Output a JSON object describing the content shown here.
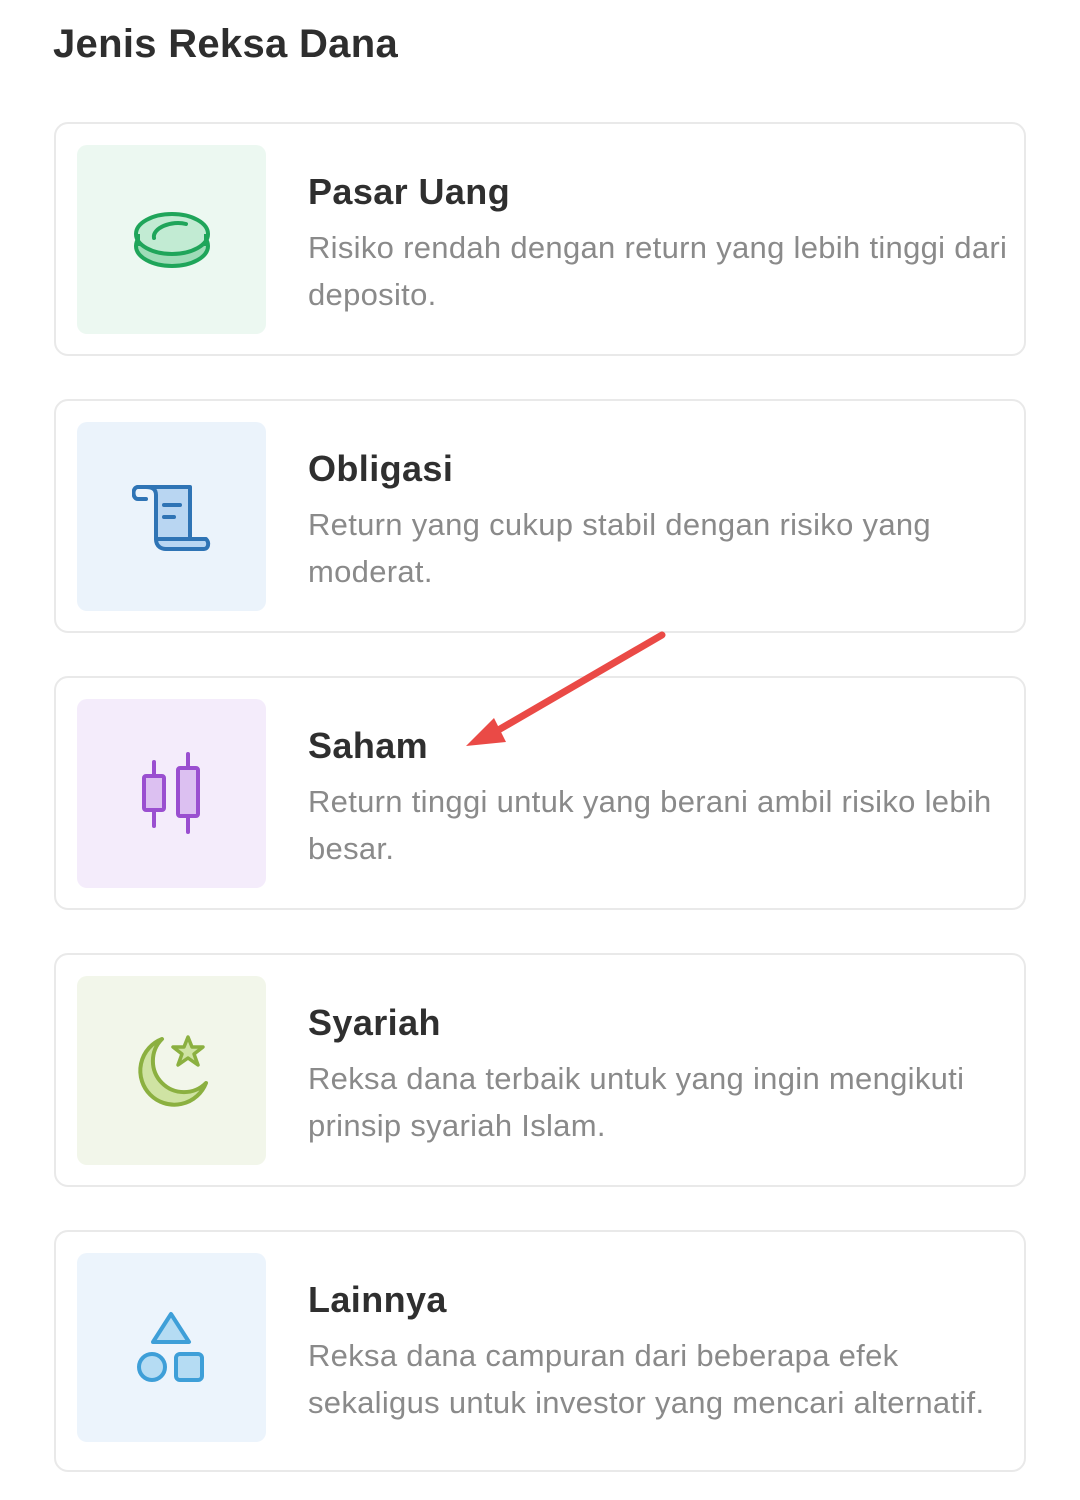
{
  "page": {
    "title": "Jenis Reksa Dana"
  },
  "cards": [
    {
      "title": "Pasar Uang",
      "description": "Risiko rendah dengan return yang lebih tinggi dari deposito.",
      "icon": "coin-icon",
      "icon_bg": "#ecf8f1",
      "icon_color": "#1fa55a"
    },
    {
      "title": "Obligasi",
      "description": "Return yang cukup stabil dengan risiko yang moderat.",
      "icon": "scroll-document-icon",
      "icon_bg": "#ebf3fb",
      "icon_color": "#2f74b5"
    },
    {
      "title": "Saham",
      "description": "Return tinggi untuk yang berani ambil risiko lebih besar.",
      "icon": "candlestick-chart-icon",
      "icon_bg": "#f4ecfb",
      "icon_color": "#9a4fd0"
    },
    {
      "title": "Syariah",
      "description": "Reksa dana terbaik untuk yang ingin mengikuti prinsip syariah Islam.",
      "icon": "crescent-star-icon",
      "icon_bg": "#f2f6ea",
      "icon_color": "#8bb040"
    },
    {
      "title": "Lainnya",
      "description": "Reksa dana campuran dari beberapa efek sekaligus untuk investor yang mencari alternatif.",
      "icon": "shapes-icon",
      "icon_bg": "#ecf4fc",
      "icon_color": "#3e9fd8"
    }
  ],
  "annotation": {
    "icon": "red-arrow-icon",
    "color": "#ea4a46"
  }
}
